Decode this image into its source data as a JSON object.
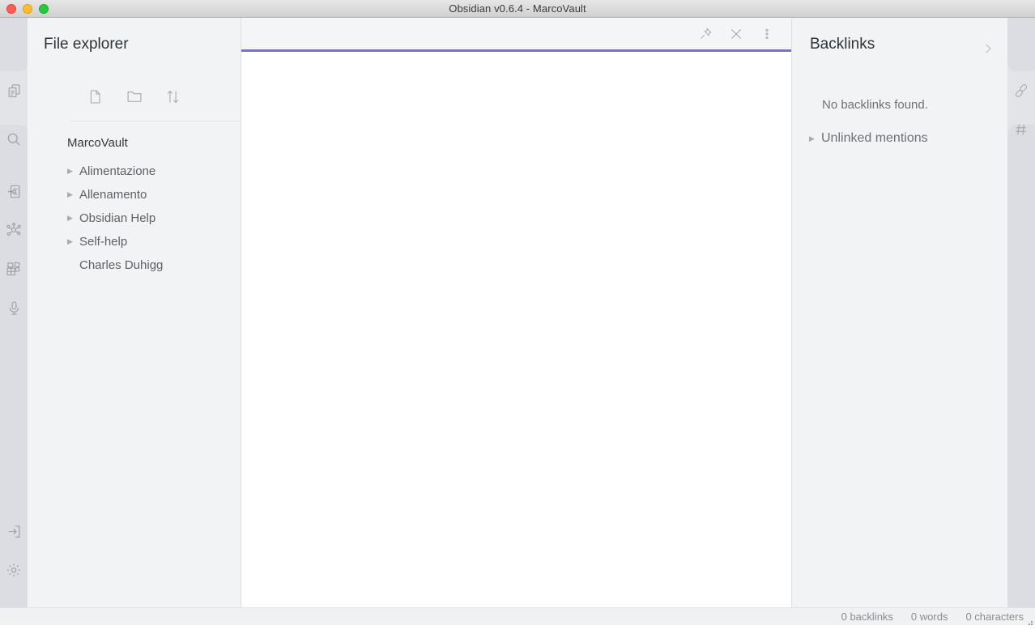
{
  "window": {
    "title": "Obsidian v0.6.4 - MarcoVault",
    "traffic_lights": [
      "close",
      "minimize",
      "zoom"
    ]
  },
  "colors": {
    "accent": "#7a6ed6",
    "panel_bg": "#f2f3f5",
    "ribbon_bg": "#dcdde2",
    "editor_bg": "#ffffff",
    "text_primary": "#2e3338",
    "text_muted": "#6d7177",
    "icon": "#a3a6ab"
  },
  "left_ribbon": {
    "items": [
      {
        "name": "file-explorer-icon",
        "icon": "documents",
        "active": true
      },
      {
        "name": "search-icon",
        "icon": "magnifier",
        "active": false
      },
      {
        "name": "quick-switcher-icon",
        "icon": "note-with-arrow",
        "active": false
      },
      {
        "name": "graph-view-icon",
        "icon": "graph-nodes",
        "active": false
      },
      {
        "name": "canvas-icon",
        "icon": "grid-shapes",
        "active": false
      },
      {
        "name": "audio-recorder-icon",
        "icon": "microphone",
        "active": false
      }
    ],
    "bottom_items": [
      {
        "name": "open-vault-icon",
        "icon": "arrow-into-box"
      },
      {
        "name": "settings-icon",
        "icon": "gear"
      }
    ]
  },
  "explorer": {
    "title": "File explorer",
    "tools": [
      {
        "label": "New note",
        "icon": "new-note-icon"
      },
      {
        "label": "New folder",
        "icon": "new-folder-icon"
      },
      {
        "label": "Change sort order",
        "icon": "sort-icon"
      }
    ],
    "vault_name": "MarcoVault",
    "tree": [
      {
        "label": "Alimentazione",
        "type": "folder",
        "collapsed": true
      },
      {
        "label": "Allenamento",
        "type": "folder",
        "collapsed": true
      },
      {
        "label": "Obsidian Help",
        "type": "folder",
        "collapsed": true
      },
      {
        "label": "Self-help",
        "type": "folder",
        "collapsed": true
      },
      {
        "label": "Charles Duhigg",
        "type": "file",
        "collapsed": false
      }
    ]
  },
  "editor": {
    "tab_title": "",
    "actions": [
      {
        "label": "Pin",
        "icon": "pin-icon"
      },
      {
        "label": "Close",
        "icon": "close-icon"
      },
      {
        "label": "More options",
        "icon": "more-vertical-icon"
      }
    ],
    "content": ""
  },
  "backlinks": {
    "title": "Backlinks",
    "collapse_label": "Collapse",
    "empty_message": "No backlinks found.",
    "unlinked_mentions_label": "Unlinked mentions"
  },
  "right_rail": {
    "items": [
      {
        "name": "backlinks-icon",
        "icon": "link-chain",
        "active": true
      },
      {
        "name": "tags-icon",
        "icon": "hash",
        "active": false
      }
    ]
  },
  "statusbar": {
    "items": [
      "0 backlinks",
      "0 words",
      "0 characters"
    ]
  }
}
